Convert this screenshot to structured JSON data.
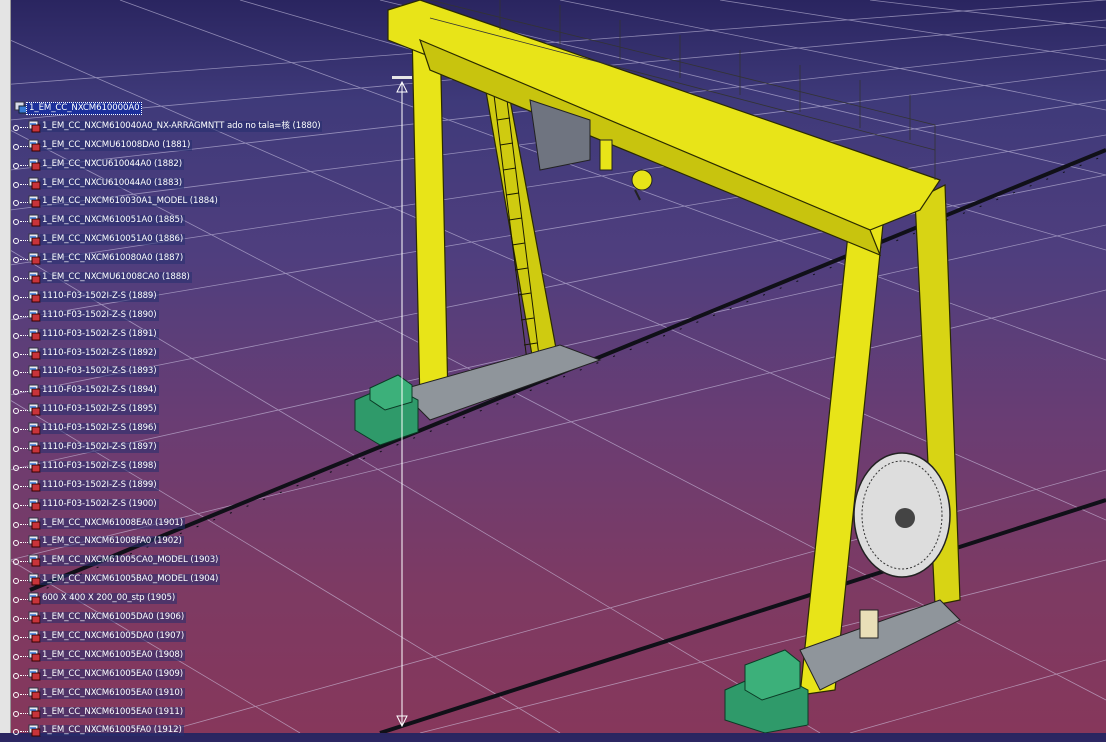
{
  "tree": {
    "root_label": "1_EM_CC_NXCM610000A0",
    "items": [
      "1_EM_CC_NXCM610040A0_NX-ARRAGMNTT ado no tala=核 (1880)",
      "1_EM_CC_NXCMU61008DA0 (1881)",
      "1_EM_CC_NXCU610044A0 (1882)",
      "1_EM_CC_NXCU610044A0 (1883)",
      "1_EM_CC_NXCM610030A1_MODEL (1884)",
      "1_EM_CC_NXCM610051A0 (1885)",
      "1_EM_CC_NXCM610051A0 (1886)",
      "1_EM_CC_NXCM610080A0 (1887)",
      "1_EM_CC_NXCMU61008CA0 (1888)",
      "1110-F03-1502I-Z-S (1889)",
      "1110-F03-1502I-Z-S (1890)",
      "1110-F03-1502I-Z-S (1891)",
      "1110-F03-1502I-Z-S (1892)",
      "1110-F03-1502I-Z-S (1893)",
      "1110-F03-1502I-Z-S (1894)",
      "1110-F03-1502I-Z-S (1895)",
      "1110-F03-1502I-Z-S (1896)",
      "1110-F03-1502I-Z-S (1897)",
      "1110-F03-1502I-Z-S (1898)",
      "1110-F03-1502I-Z-S (1899)",
      "1110-F03-1502I-Z-S (1900)",
      "1_EM_CC_NXCM61008EA0 (1901)",
      "1_EM_CC_NXCM61008FA0 (1902)",
      "1_EM_CC_NXCM61005CA0_MODEL (1903)",
      "1_EM_CC_NXCM61005BA0_MODEL (1904)",
      "600 X 400 X 200_00_stp (1905)",
      "1_EM_CC_NXCM61005DA0 (1906)",
      "1_EM_CC_NXCM61005DA0 (1907)",
      "1_EM_CC_NXCM61005EA0 (1908)",
      "1_EM_CC_NXCM61005EA0 (1909)",
      "1_EM_CC_NXCM61005EA0 (1910)",
      "1_EM_CC_NXCM61005EA0 (1911)",
      "1_EM_CC_NXCM61005FA0 (1912)"
    ]
  },
  "colors": {
    "crane_yellow": "#e8e418",
    "motor_green": "#2f9a6a",
    "grid_line": "#d9d3ef",
    "selection": "#1c2f9a"
  },
  "icons": [
    "part-node-icon",
    "product-node-icon",
    "tree-connector-icon"
  ]
}
